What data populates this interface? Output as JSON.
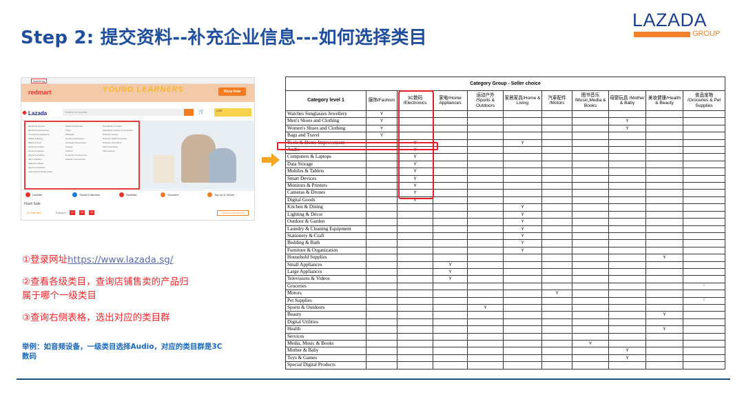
{
  "slide": {
    "title": "Step 2: 提交资料--补充企业信息---如何选择类目"
  },
  "logo": {
    "word": "LAZADA",
    "group": "GROUP",
    "colors": {
      "blue": "#1a3f8c",
      "orange": "#f0812a"
    }
  },
  "screenshot": {
    "url": "lazada.sg",
    "redmart": "redmart",
    "promo": "YOUNG LEARNERS",
    "shop_now": "Shop Now",
    "lazada": "Lazada",
    "search_placeholder": "Search in Lazada",
    "live": "LIVE",
    "menu_col1": [
      "Electronic Devices",
      "Electronic Accessories",
      "TV & Home Appliances",
      "Health & Beauty",
      "Babies & Toys",
      "Groceries & Pets",
      "Home & Lifestyle",
      "Women's Fashion",
      "Men's Fashion",
      "Watches & Bags",
      "Sports & Outdoors",
      "Automotive & Motorcycles"
    ],
    "menu_col2": [
      "Mobile Accessories",
      "Audio",
      "Wearable",
      "Camera Accessories",
      "Computer Accessories",
      "Storage",
      "Printers",
      "Computer Components",
      "Network Components"
    ],
    "menu_col3": [
      "PlayStation Consoles",
      "PlayStation Games & Controllers",
      "Nintendo Games",
      "Nintendo Switch Consoles",
      "Nintendo Controllers",
      "Xbox Controllers",
      "Xbox Games"
    ],
    "nav": [
      "LazMall",
      "Global Collection",
      "RedMart",
      "Vouchers",
      "Top Up & eStore"
    ],
    "flash_sale": "Flash Sale",
    "on_sale_now": "On Sale Now",
    "ending_in": "Ending in",
    "timer": [
      "07",
      "08",
      "13"
    ],
    "shop_all": "SHOP ALL PRODUCTS"
  },
  "steps": {
    "s1_text": "①登录网址",
    "s1_link": "https://www.lazada.sg/",
    "s2_line1": "②查看各级类目，查询店铺售卖的产品归",
    "s2_line2": "属于哪个一级类目",
    "s3": "③查询右侧表格，选出对应的类目群"
  },
  "example": {
    "line1": "举例：如音频设备，一级类目选择Audio，对应的类目群是3C",
    "line2": "数码"
  },
  "table": {
    "group_title": "Category Group - Seller choice",
    "level_header": "Category level 1",
    "columns": [
      "服饰/Fashion",
      "3C数码 /Electronics",
      "家电/Home Appliances",
      "运动户外 /Sports & Outdoors",
      "家居家具/Home & Living",
      "汽車配件 /Motors",
      "图书音乐 /Music,Media & Books",
      "母婴玩具 /Mother & Baby",
      "美妆健康/Health & Beauty",
      "食品宠物 /Groceries & Pet Supplies"
    ],
    "rows": [
      {
        "name": "Watches Sunglasses Jewellery",
        "col": 0
      },
      {
        "name": "Men's Shoes and Clothing",
        "col": 0,
        "extra": 7
      },
      {
        "name": "Women's Shoes and Clothing",
        "col": 0,
        "extra": 7
      },
      {
        "name": "Bags and Travel",
        "col": 0
      },
      {
        "name": "Tools & Home Improvement",
        "col": 1,
        "extra": 4
      },
      {
        "name": "Audio",
        "col": 1
      },
      {
        "name": "Computers & Laptops",
        "col": 1
      },
      {
        "name": "Data Storage",
        "col": 1
      },
      {
        "name": "Mobiles & Tablets",
        "col": 1
      },
      {
        "name": "Smart Devices",
        "col": 1
      },
      {
        "name": "Monitors & Printers",
        "col": 1
      },
      {
        "name": "Cameras & Drones",
        "col": 1
      },
      {
        "name": "Digital Goods",
        "col": 1
      },
      {
        "name": "Kitchen & Dining",
        "col": 4
      },
      {
        "name": "Lighting & Décor",
        "col": 4
      },
      {
        "name": "Outdoor & Garden",
        "col": 4
      },
      {
        "name": "Laundry & Cleaning Equipment",
        "col": 4
      },
      {
        "name": "Stationery & Craft",
        "col": 4
      },
      {
        "name": "Bedding & Bath",
        "col": 4
      },
      {
        "name": "Furniture & Organization",
        "col": 4
      },
      {
        "name": "Household Supplies",
        "col": 8
      },
      {
        "name": "Small Appliances",
        "col": 2
      },
      {
        "name": "Large Appliances",
        "col": 2
      },
      {
        "name": "Televisions & Videos",
        "col": 2
      },
      {
        "name": "Groceries",
        "col": 9,
        "faint": true
      },
      {
        "name": "Motors",
        "col": 5
      },
      {
        "name": "Pet Supplies",
        "col": 9,
        "faint": true
      },
      {
        "name": "Sports & Outdoors",
        "col": 3
      },
      {
        "name": "Beauty",
        "col": 8
      },
      {
        "name": "Digital Utilities",
        "col": -1
      },
      {
        "name": "Health",
        "col": 8
      },
      {
        "name": "Services",
        "col": -1
      },
      {
        "name": "Media, Music & Books",
        "col": 6
      },
      {
        "name": "Mother & Baby",
        "col": 7
      },
      {
        "name": "Toys & Games",
        "col": 7
      },
      {
        "name": "Special Digital Products",
        "col": -1
      }
    ],
    "mark": "Y"
  },
  "colors": {
    "title": "#1f4e9c",
    "step_red": "#e8282e",
    "example_blue": "#1a67b8",
    "highlight": "#e81c24",
    "arrow": "#f5a623"
  }
}
